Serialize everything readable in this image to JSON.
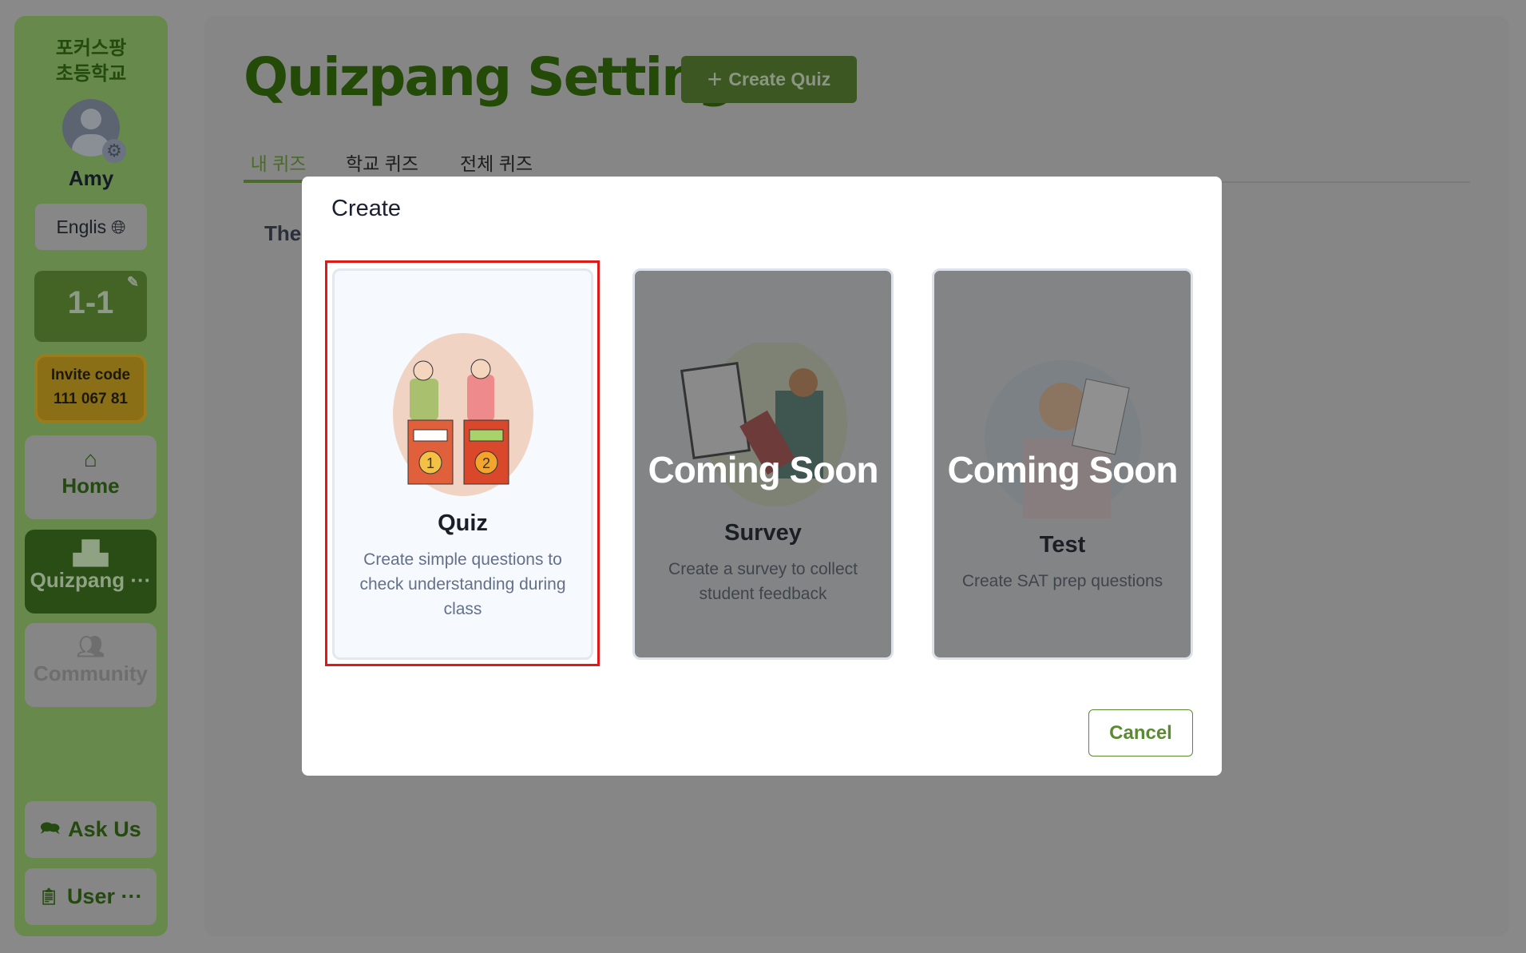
{
  "sidebar": {
    "school_name": "포커스팡 초등학교",
    "user_name": "Amy",
    "language": "Englis",
    "class_name": "1-1",
    "invite_label": "Invite code",
    "invite_code": "111 067 81",
    "nav": [
      {
        "label": "Home",
        "icon": "home-icon"
      },
      {
        "label": "Quizpang ···",
        "icon": "podium-icon"
      },
      {
        "label": "Community",
        "icon": "people-icon"
      }
    ],
    "ask_us": "Ask Us",
    "user": "User ···"
  },
  "header": {
    "title": "Quizpang Settings",
    "create_quiz": "Create Quiz"
  },
  "tabs": [
    "내 퀴즈",
    "학교 퀴즈",
    "전체 퀴즈"
  ],
  "partial_text": "The",
  "modal": {
    "title": "Create",
    "coming_soon": "Coming Soon",
    "cards": [
      {
        "title": "Quiz",
        "desc": "Create simple questions to check understanding during class",
        "available": true,
        "selected": true
      },
      {
        "title": "Survey",
        "desc": "Create a survey to collect student feedback",
        "available": false
      },
      {
        "title": "Test",
        "desc": "Create SAT prep questions",
        "available": false
      }
    ],
    "cancel": "Cancel"
  },
  "colors": {
    "brand": "#244a08",
    "selection": "#e01818",
    "cancel": "#5b8a32"
  }
}
